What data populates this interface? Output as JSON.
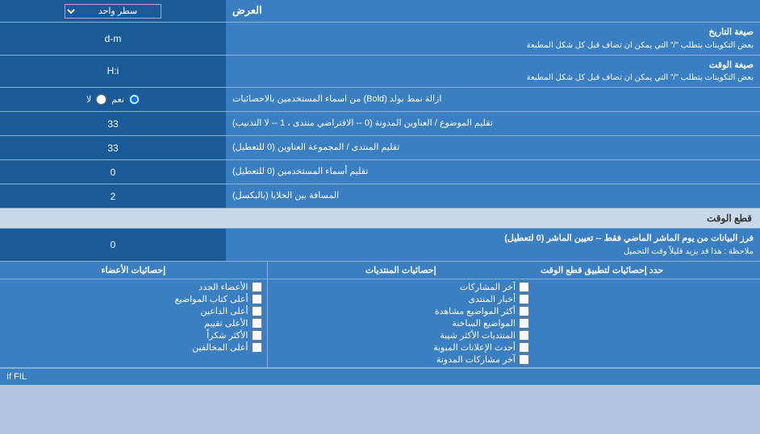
{
  "header": {
    "title": "العرض",
    "dropdown_label": "سطر واحد"
  },
  "rows": [
    {
      "id": "date_format",
      "label": "صيغة التاريخ",
      "sublabel": "بعض التكوينات يتطلب \"/\" التي يمكن ان تضاف قبل كل شكل المطبعة",
      "value": "d-m"
    },
    {
      "id": "time_format",
      "label": "صيغة الوقت",
      "sublabel": "بعض التكوينات يتطلب \"/\" التي يمكن ان تضاف قبل كل شكل المطبعة",
      "value": "H:i"
    },
    {
      "id": "bold_remove",
      "label": "ازالة نمط بولد (Bold) من اسماء المستخدمين بالاحصائيات",
      "type": "radio",
      "options": [
        "نعم",
        "لا"
      ],
      "selected": "نعم"
    },
    {
      "id": "topics_limit",
      "label": "تقليم الموضوع / العناوين المدونة (0 -- الافتراضي منتدى ، 1 -- لا التذنيب)",
      "value": "33"
    },
    {
      "id": "forum_limit",
      "label": "تقليم المنتدى / المجموعة العناوين (0 للتعطيل)",
      "value": "33"
    },
    {
      "id": "usernames_limit",
      "label": "تقليم أسماء المستخدمين (0 للتعطيل)",
      "value": "0"
    },
    {
      "id": "cell_spacing",
      "label": "المسافة بين الخلايا (بالبكسل)",
      "value": "2"
    }
  ],
  "cut_section": {
    "title": "قطع الوقت",
    "row": {
      "label": "فرز البيانات من يوم الماشر الماضي فقط -- تعيين الماشر (0 لتعطيل)",
      "note": "ملاحظة : هذا قد يزيد قليلاً وقت التحميل",
      "value": "0"
    }
  },
  "stats_section": {
    "apply_label": "حدد إحصائيات لتطبيق قطع الوقت",
    "col1_header": "إحصائيات المنتديات",
    "col2_header": "إحصائيات الأعضاء",
    "col1_items": [
      "آخر المشاركات",
      "أخبار المنتدى",
      "أكثر المواضيع مشاهدة",
      "المواضيع الساخنة",
      "المنتديات الأكثر شيبة",
      "أحدث الإعلانات المبوبة",
      "آخر مشاركات المدونة"
    ],
    "col2_items": [
      "الأعضاء الجدد",
      "أعلى كتاب المواضيع",
      "أعلى الداعين",
      "الأعلى تقييم",
      "الأكثر شكراً",
      "أعلى المخالفين"
    ]
  },
  "if_fil_text": "If FIL"
}
